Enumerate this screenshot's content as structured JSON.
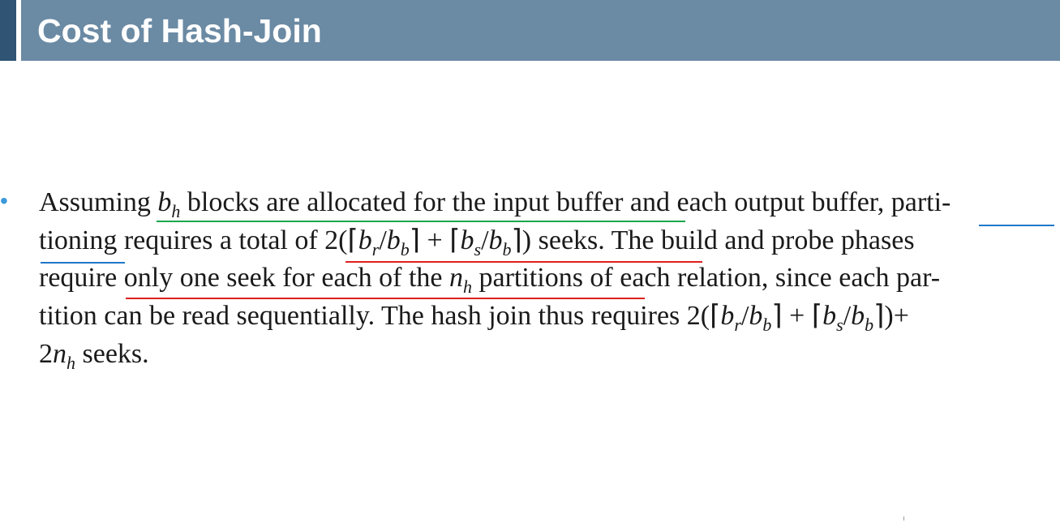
{
  "slide": {
    "title": "Cost of Hash-Join",
    "bullet_symbol": "•",
    "lines": [
      {
        "segments": [
          {
            "t": "Assuming "
          },
          {
            "t": "b",
            "i": true
          },
          {
            "t": "h",
            "sub": true,
            "i": true
          },
          {
            "t": " blocks are allocated for the input buffer and each output buffer, parti-"
          }
        ]
      },
      {
        "segments": [
          {
            "t": "tioning requires a total of 2(⌈"
          },
          {
            "t": "b",
            "i": true
          },
          {
            "t": "r",
            "sub": true,
            "i": true
          },
          {
            "t": "/"
          },
          {
            "t": "b",
            "i": true
          },
          {
            "t": "b",
            "sub": true,
            "i": true
          },
          {
            "t": "⌉ + ⌈"
          },
          {
            "t": "b",
            "i": true
          },
          {
            "t": "s",
            "sub": true,
            "i": true
          },
          {
            "t": "/"
          },
          {
            "t": "b",
            "i": true
          },
          {
            "t": "b",
            "sub": true,
            "i": true
          },
          {
            "t": "⌉) seeks. The build and probe phases"
          }
        ]
      },
      {
        "segments": [
          {
            "t": "require only one seek for each of the "
          },
          {
            "t": "n",
            "i": true
          },
          {
            "t": "h",
            "sub": true,
            "i": true
          },
          {
            "t": " partitions of each relation, since each par-"
          }
        ]
      },
      {
        "segments": [
          {
            "t": "tition can be read sequentially. The hash join thus requires 2(⌈"
          },
          {
            "t": "b",
            "i": true
          },
          {
            "t": "r",
            "sub": true,
            "i": true
          },
          {
            "t": "/"
          },
          {
            "t": "b",
            "i": true
          },
          {
            "t": "b",
            "sub": true,
            "i": true
          },
          {
            "t": "⌉ + ⌈"
          },
          {
            "t": "b",
            "i": true
          },
          {
            "t": "s",
            "sub": true,
            "i": true
          },
          {
            "t": "/"
          },
          {
            "t": "b",
            "i": true
          },
          {
            "t": "b",
            "sub": true,
            "i": true
          },
          {
            "t": "⌉)+"
          }
        ]
      },
      {
        "segments": [
          {
            "t": "2"
          },
          {
            "t": "n",
            "i": true
          },
          {
            "t": "h",
            "sub": true,
            "i": true
          },
          {
            "t": " seeks."
          }
        ]
      }
    ]
  },
  "colors": {
    "title_bar": "#6b8aa4",
    "title_accent": "#2f5474",
    "bullet": "#3b9ad9",
    "underline_green": "#1aa64a",
    "underline_blue": "#1f78c8",
    "underline_red": "#e02020"
  }
}
